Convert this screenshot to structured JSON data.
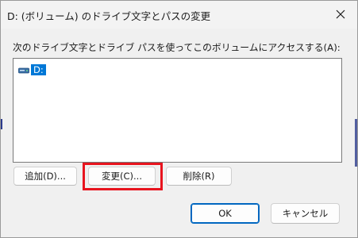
{
  "window": {
    "title": "D: (ボリューム) のドライブ文字とパスの変更",
    "close_icon": "close-icon"
  },
  "prompt": "次のドライブ文字とドライブ パスを使ってこのボリュームにアクセスする(A):",
  "list": {
    "items": [
      {
        "icon": "drive-icon",
        "label": "D:",
        "selected": true
      }
    ]
  },
  "buttons": {
    "add": "追加(D)...",
    "change": "変更(C)...",
    "delete": "削除(R)",
    "ok": "OK",
    "cancel": "キャンセル"
  },
  "colors": {
    "selection": "#0078d7",
    "highlight_box": "#e8141e",
    "default_button_border": "#0067c0"
  }
}
